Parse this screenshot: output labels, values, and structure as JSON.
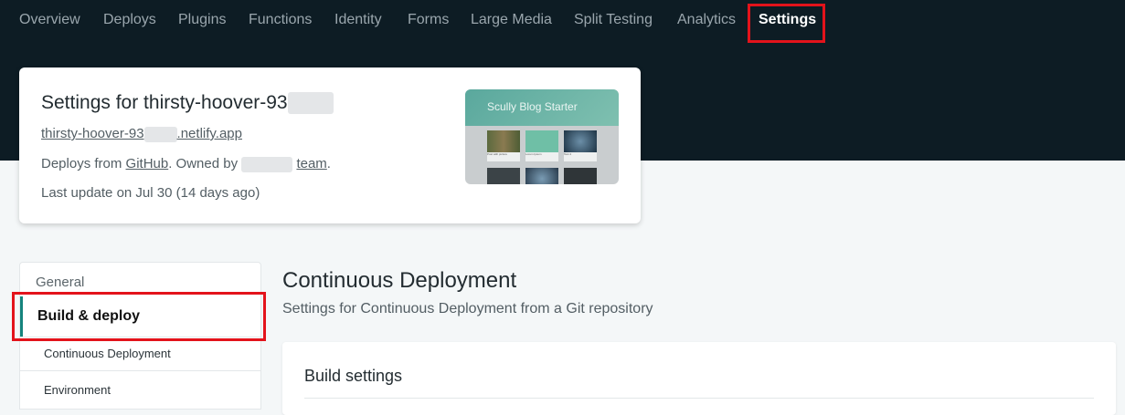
{
  "nav": {
    "items": [
      "Overview",
      "Deploys",
      "Plugins",
      "Functions",
      "Identity",
      "Forms",
      "Large Media",
      "Split Testing",
      "Analytics",
      "Settings"
    ],
    "active": "Settings"
  },
  "site": {
    "title": "Settings for thirsty-hoover-93",
    "url_prefix": "thirsty-hoover-93",
    "url_suffix": ".netlify.app",
    "deploys_from_label": "Deploys from",
    "deploys_provider": "GitHub",
    "owned_by_label": ". Owned by",
    "team_label": "team",
    "period": ".",
    "last_update": "Last update on Jul 30 (14 days ago)",
    "preview": {
      "title": "Scully Blog Starter",
      "captions": [
        "Post with picture",
        "Lorem Ipsum",
        "Test 4"
      ]
    }
  },
  "sidebar": {
    "general": "General",
    "build_deploy": "Build & deploy",
    "sub_items": [
      "Continuous Deployment",
      "Environment"
    ]
  },
  "main": {
    "title": "Continuous Deployment",
    "subtitle": "Settings for Continuous Deployment from a Git repository",
    "panel_title": "Build settings"
  },
  "colors": {
    "header_bg": "#0d1c24",
    "accent": "#15847d",
    "highlight": "#e3131b"
  }
}
